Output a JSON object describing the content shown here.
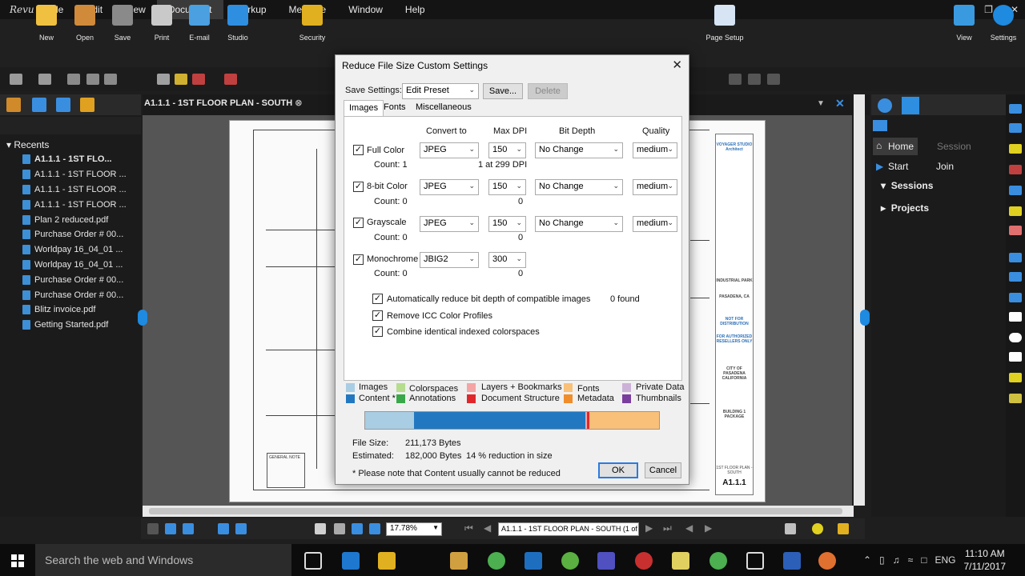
{
  "app": {
    "logo": "Revu",
    "menu": [
      "File",
      "Edit",
      "View",
      "Document",
      "Markup",
      "Measure",
      "Window",
      "Help"
    ],
    "active_menu": "Document"
  },
  "ribbon": {
    "buttons": [
      "New",
      "Open",
      "Save",
      "Print",
      "E-mail",
      "Studio",
      "Security",
      "Page Setup",
      "View",
      "Settings"
    ]
  },
  "left_panel": {
    "recents_label": "Recents",
    "items": [
      {
        "name": "A1.1.1 - 1ST FLO...",
        "bold": true
      },
      {
        "name": "A1.1.1 - 1ST FLOOR ...",
        "bold": false
      },
      {
        "name": "A1.1.1 - 1ST FLOOR ...",
        "bold": false
      },
      {
        "name": "A1.1.1 - 1ST FLOOR ...",
        "bold": false
      },
      {
        "name": "Plan 2 reduced.pdf",
        "bold": false
      },
      {
        "name": "Purchase Order # 00...",
        "bold": false
      },
      {
        "name": "Worldpay 16_04_01 ...",
        "bold": false
      },
      {
        "name": "Worldpay 16_04_01 ...",
        "bold": false
      },
      {
        "name": "Purchase Order # 00...",
        "bold": false
      },
      {
        "name": "Purchase Order # 00...",
        "bold": false
      },
      {
        "name": "Blitz invoice.pdf",
        "bold": false
      },
      {
        "name": "Getting Started.pdf",
        "bold": false
      }
    ]
  },
  "document": {
    "tab_title": "A1.1.1 - 1ST FLOOR PLAN - SOUTH",
    "title_block": {
      "firm": "VOYAGER STUDIO Architect",
      "project1": "INDUSTRIAL PARK",
      "project2": "PASADENA, CA",
      "notice1": "NOT FOR DISTRIBUTION",
      "notice2": "FOR AUTHORIZED RESELLERS ONLY",
      "city": "CITY OF PASADENA CALIFORNIA",
      "package": "BUILDING 1 PACKAGE",
      "sheet_title": "1ST FLOOR PLAN - SOUTH",
      "sheet_number": "A1.1.1",
      "general_note": "GENERAL NOTE"
    }
  },
  "right_panel": {
    "home": "Home",
    "session": "Session",
    "start": "Start",
    "join": "Join",
    "sessions": "Sessions",
    "projects": "Projects"
  },
  "bottom_bar": {
    "zoom": "17.78%",
    "page": "A1.1.1 - 1ST FLOOR PLAN - SOUTH (1 of 1)"
  },
  "taskbar": {
    "search_placeholder": "Search the web and Windows",
    "language": "ENG",
    "time": "11:10 AM",
    "date": "7/11/2017"
  },
  "dialog": {
    "title": "Reduce File Size Custom Settings",
    "save_settings_label": "Save Settings:",
    "preset": "Edit Preset",
    "save_button": "Save...",
    "delete_button": "Delete",
    "tabs": [
      "Images",
      "Fonts",
      "Miscellaneous"
    ],
    "active_tab": "Images",
    "columns": {
      "convert_to": "Convert to",
      "max_dpi": "Max DPI",
      "bit_depth": "Bit Depth",
      "quality": "Quality"
    },
    "rows": [
      {
        "label": "Full Color",
        "checked": true,
        "count": "Count: 1",
        "convert": "JPEG",
        "dpi": "150",
        "dpi_note": "1 at 299 DPI",
        "bit_depth": "No Change",
        "quality": "medium"
      },
      {
        "label": "8-bit Color",
        "checked": true,
        "count": "Count: 0",
        "convert": "JPEG",
        "dpi": "150",
        "dpi_note": "0",
        "bit_depth": "No Change",
        "quality": "medium"
      },
      {
        "label": "Grayscale",
        "checked": true,
        "count": "Count: 0",
        "convert": "JPEG",
        "dpi": "150",
        "dpi_note": "0",
        "bit_depth": "No Change",
        "quality": "medium"
      },
      {
        "label": "Monochrome",
        "checked": true,
        "count": "Count: 0",
        "convert": "JBIG2",
        "dpi": "300",
        "dpi_note": "0",
        "bit_depth": "",
        "quality": ""
      }
    ],
    "options": [
      {
        "label": "Automatically reduce bit depth of compatible images",
        "checked": true,
        "note": "0 found"
      },
      {
        "label": "Remove ICC Color Profiles",
        "checked": true,
        "note": ""
      },
      {
        "label": "Combine identical indexed colorspaces",
        "checked": true,
        "note": ""
      }
    ],
    "legend": [
      {
        "label": "Images",
        "color": "#a9cde3"
      },
      {
        "label": "Content *",
        "color": "#2278c0"
      },
      {
        "label": "Colorspaces",
        "color": "#b6dc8e"
      },
      {
        "label": "Annotations",
        "color": "#3aa84a"
      },
      {
        "label": "Layers + Bookmarks",
        "color": "#f4a4a4"
      },
      {
        "label": "Document Structure",
        "color": "#e0282c"
      },
      {
        "label": "Fonts",
        "color": "#f8c078"
      },
      {
        "label": "Metadata",
        "color": "#f08d2a"
      },
      {
        "label": "Private Data",
        "color": "#cdb2d8"
      },
      {
        "label": "Thumbnails",
        "color": "#7a3e9e"
      }
    ],
    "composition": [
      {
        "part": "Images",
        "share": 0.165,
        "color": "#a9cde3"
      },
      {
        "part": "Content",
        "share": 0.585,
        "color": "#2278c0"
      },
      {
        "part": "Layers + Bookmarks",
        "share": 0.004,
        "color": "#f4a4a4"
      },
      {
        "part": "Document Structure",
        "share": 0.008,
        "color": "#e0282c"
      },
      {
        "part": "Fonts",
        "share": 0.238,
        "color": "#f8c078"
      }
    ],
    "file_size_label": "File Size:",
    "file_size": "211,173 Bytes",
    "estimated_label": "Estimated:",
    "estimated": "182,000 Bytes",
    "reduction": "14 % reduction in size",
    "footnote": "* Please note that Content usually cannot be reduced",
    "ok": "OK",
    "cancel": "Cancel"
  }
}
